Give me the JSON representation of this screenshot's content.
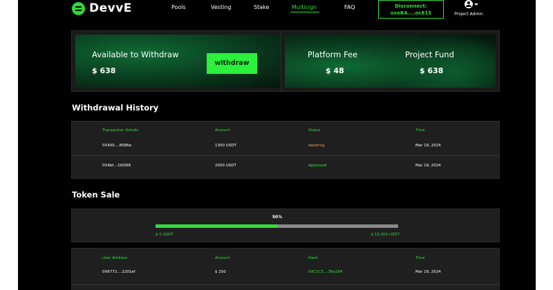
{
  "brand": {
    "name": "DevvE"
  },
  "nav": {
    "items": [
      {
        "label": "Pools",
        "active": false
      },
      {
        "label": "Vesting",
        "active": false
      },
      {
        "label": "Stake",
        "active": false
      },
      {
        "label": "Multisign",
        "active": true
      },
      {
        "label": "FAQ",
        "active": false
      }
    ],
    "disconnect_label": "Disconnect:",
    "wallet_address": "oxeBA....oc615",
    "profile_label": "Project Admin"
  },
  "cards": {
    "withdraw": {
      "title": "Available to Withdraw",
      "amount": "$ 638",
      "button_label": "withdraw"
    },
    "platform_fee": {
      "title": "Platform Fee",
      "amount": "$ 48"
    },
    "project_fund": {
      "title": "Project Fund",
      "amount": "$ 638"
    }
  },
  "withdrawal_history": {
    "title": "Withdrawal History",
    "columns": [
      "Transaction Details",
      "Amount",
      "Status",
      "Time"
    ],
    "rows": [
      {
        "details": "0X400....8586e",
        "amount": "1300 USDT",
        "status": "Awaiting",
        "time": "Mar 19, 2024"
      },
      {
        "details": "0X4bf....D0068",
        "amount": "2000 USDT",
        "status": "Approved",
        "time": "Mar 19, 2024"
      }
    ]
  },
  "token_sale": {
    "title": "Token Sale",
    "progress_percent_label": "50%",
    "progress_fraction": 0.5,
    "min_label": "$ 0 USDT",
    "max_label": "$ 10,000 USDT",
    "columns": [
      "User Address",
      "Amount",
      "Hash",
      "Time"
    ],
    "rows": [
      {
        "address": "0X6772....2201ef",
        "amount": "$ 250",
        "hash": "0XC1C3....36e284",
        "time": "Mar 19, 2024"
      }
    ]
  },
  "colors": {
    "accent": "#31e03b",
    "awaiting": "#e7a23c",
    "background": "#000000",
    "panel": "#1f1f1f"
  }
}
